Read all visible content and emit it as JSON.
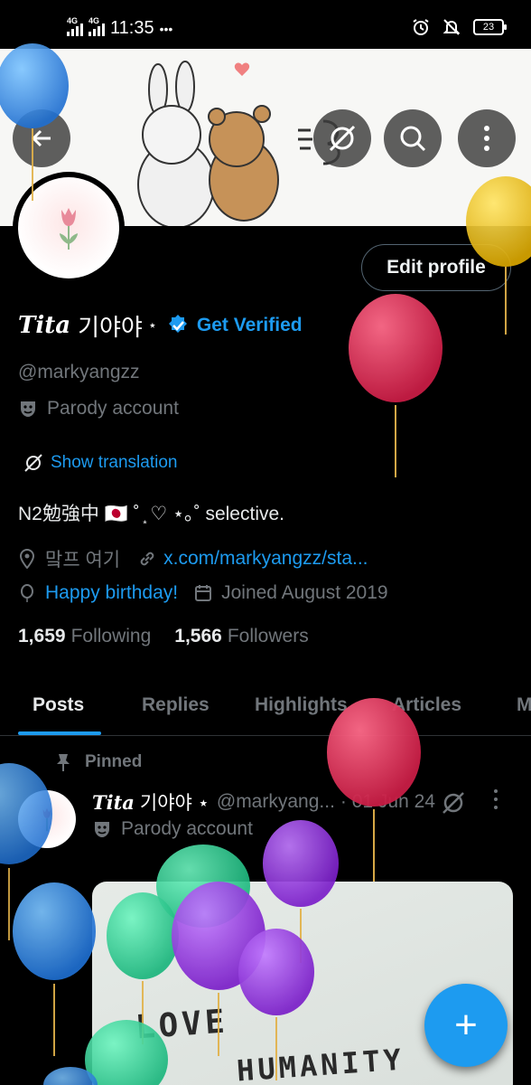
{
  "status_bar": {
    "net1": "4G",
    "net2": "4G",
    "time": "11:35",
    "dots": "•••",
    "battery": "23"
  },
  "profile": {
    "display_name": "Tita",
    "display_name_suffix": "기야야",
    "name_star": "⋆",
    "get_verified": "Get Verified",
    "edit_profile": "Edit profile",
    "handle": "@markyangzz",
    "parody_label": "Parody account",
    "show_translation": "Show translation",
    "bio": "N2勉強中 🇯🇵 ˚ ͙ ♡ ⋆｡˚ selective.",
    "location": "맠프 여기",
    "website": "x.com/markyangzz/sta...",
    "birthday": "Happy birthday!",
    "joined": "Joined August 2019",
    "following_count": "1,659",
    "following_label": "Following",
    "followers_count": "1,566",
    "followers_label": "Followers"
  },
  "tabs": [
    {
      "label": "Posts",
      "active": true
    },
    {
      "label": "Replies"
    },
    {
      "label": "Highlights"
    },
    {
      "label": "Articles"
    },
    {
      "label": "M"
    }
  ],
  "pinned_post": {
    "pinned_label": "Pinned",
    "name": "Tita",
    "name_suffix": "기야야 ⋆",
    "handle": "@markyang...",
    "date": "· 01 Jun 24",
    "parody_label": "Parody account",
    "media_text_1": "LOVE",
    "media_text_2": "HUMANITY"
  },
  "fab": {
    "icon": "plus-icon",
    "label": "+"
  },
  "colors": {
    "accent": "#1d9bf0",
    "muted": "#71767b",
    "background": "#000000"
  }
}
